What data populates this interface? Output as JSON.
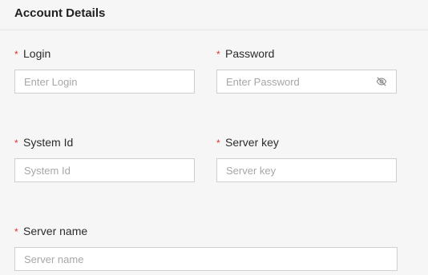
{
  "section": {
    "title": "Account Details"
  },
  "required_marker": "*",
  "fields": {
    "login": {
      "label": "Login",
      "placeholder": "Enter Login",
      "value": ""
    },
    "password": {
      "label": "Password",
      "placeholder": "Enter Password",
      "value": "",
      "toggle_icon": "eye-slash-icon"
    },
    "system_id": {
      "label": "System Id",
      "placeholder": "System Id",
      "value": ""
    },
    "server_key": {
      "label": "Server key",
      "placeholder": "Server key",
      "value": ""
    },
    "server_name": {
      "label": "Server name",
      "placeholder": "Server name",
      "value": ""
    }
  },
  "colors": {
    "required": "#e0322b",
    "background": "#f6f6f6",
    "border": "#cfcfcf"
  }
}
